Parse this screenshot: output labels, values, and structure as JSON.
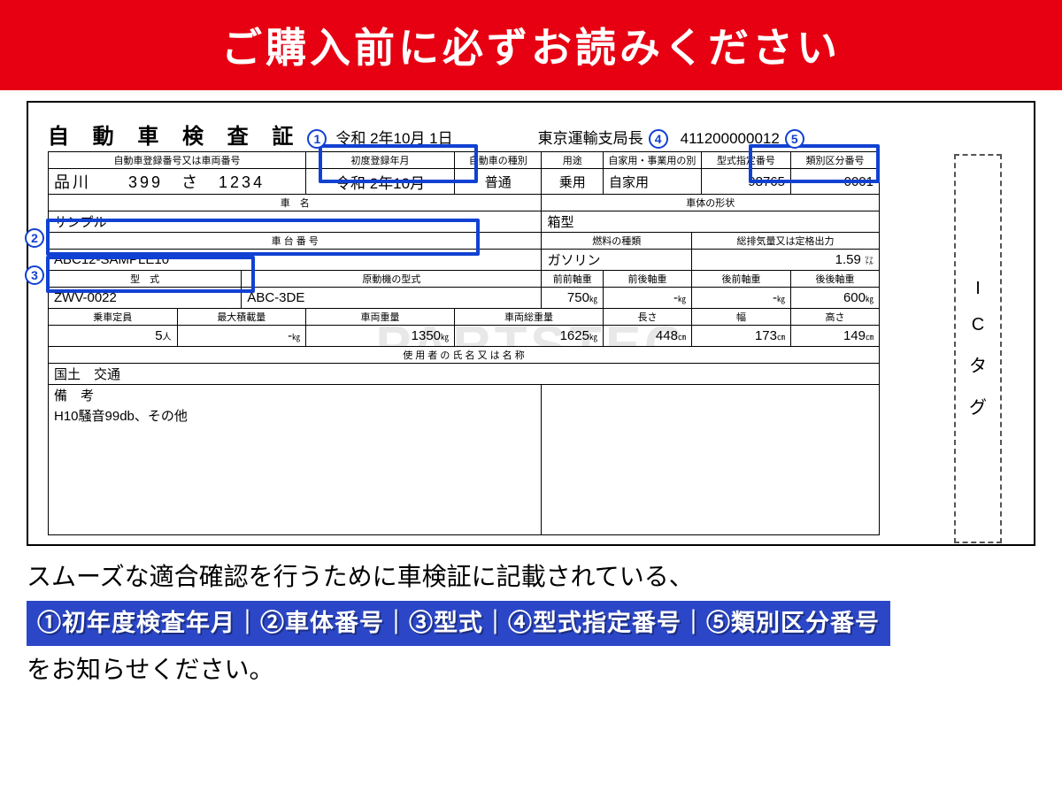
{
  "header_title": "ご購入前に必ずお読みください",
  "certificate": {
    "title": "自 動 車 検 査 証",
    "issue_date": "令和 2年10月 1日",
    "issuer": "東京運輸支局長",
    "serial": "411200000012",
    "row1": {
      "h_plate": "自動車登録番号又は車両番号",
      "h_first": "初度登録年月",
      "h_type": "自動車の種別",
      "h_use": "用途",
      "h_private": "自家用・事業用の別",
      "h_model_no": "型式指定番号",
      "h_class_no": "類別区分番号"
    },
    "vals1": {
      "plate": "品川　　399　さ　1234",
      "first": "令和 2年10月",
      "type": "普通",
      "use": "乗用",
      "private": "自家用",
      "model_no": "98765",
      "class_no": "0001"
    },
    "row2": {
      "h_name": "車　名",
      "h_shape": "車体の形状"
    },
    "vals2": {
      "name": "サンプル",
      "shape": "箱型"
    },
    "row3": {
      "h_frame": "車 台 番 号",
      "h_fuel": "燃料の種類",
      "h_disp": "総排気量又は定格出力"
    },
    "vals3": {
      "frame": "ABC12-SAMPLE10",
      "fuel": "ガソリン",
      "disp": "1.59",
      "disp_unit": "㍑"
    },
    "row4": {
      "h_model": "型　式",
      "h_engine": "原動機の型式",
      "h_faxle": "前前軸重",
      "h_raxle1": "前後軸重",
      "h_raxle2": "後前軸重",
      "h_raxle3": "後後軸重"
    },
    "vals4": {
      "model": "ZWV-0022",
      "engine": "ABC-3DE",
      "faxle": "750",
      "raxle1": "-",
      "raxle2": "-",
      "raxle3": "600",
      "unit": "㎏"
    },
    "row5": {
      "h_cap": "乗車定員",
      "h_load": "最大積載量",
      "h_weight": "車両重量",
      "h_gross": "車両総重量",
      "h_len": "長さ",
      "h_wid": "幅",
      "h_hei": "高さ"
    },
    "vals5": {
      "cap": "5",
      "cap_u": "人",
      "load": "-",
      "load_u": "㎏",
      "weight": "1350",
      "gross": "1625",
      "len": "448",
      "wid": "173",
      "hei": "149",
      "cm": "㎝"
    },
    "row6": {
      "h_user": "使 用 者 の 氏 名 又 は 名 称",
      "user": "国土　交通"
    },
    "row7": {
      "h_remark": "備　考",
      "remark": "H10騒音99db、その他"
    },
    "ictag": "ICタグ"
  },
  "badges": {
    "b1": "1",
    "b2": "2",
    "b3": "3",
    "b4": "4",
    "b5": "5"
  },
  "footer": {
    "line1": "スムーズな適合確認を行うために車検証に記載されている、",
    "highlight": "①初年度検査年月｜②車体番号｜③型式｜④型式指定番号｜⑤類別区分番号",
    "line3": "をお知らせください。"
  },
  "watermark": "PARTSTEC"
}
